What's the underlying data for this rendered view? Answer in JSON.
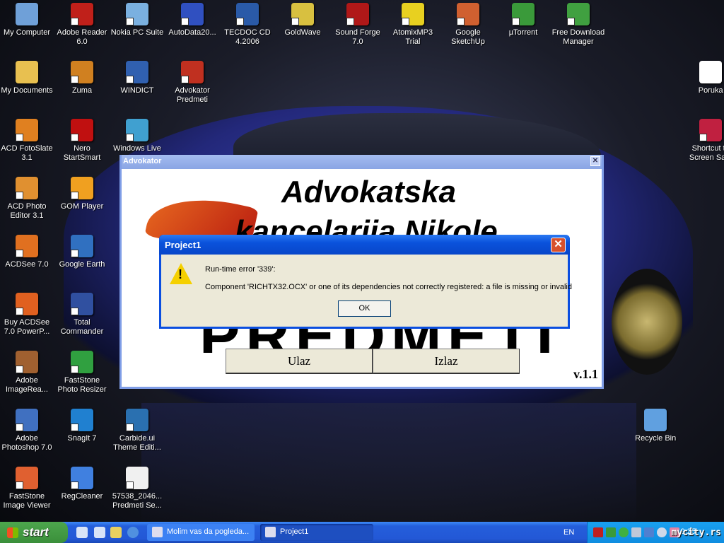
{
  "desktop_icons": [
    {
      "label": "My Computer",
      "col": 0,
      "row": 0,
      "color": "#6fa0d8",
      "shortcut": false
    },
    {
      "label": "Adobe Reader 6.0",
      "col": 1,
      "row": 0,
      "color": "#c0201a",
      "shortcut": true
    },
    {
      "label": "Nokia PC Suite",
      "col": 2,
      "row": 0,
      "color": "#7ab0e0",
      "shortcut": true
    },
    {
      "label": "AutoData20...",
      "col": 3,
      "row": 0,
      "color": "#3050c0",
      "shortcut": true
    },
    {
      "label": "TECDOC CD 4.2006",
      "col": 4,
      "row": 0,
      "color": "#2a5aa8",
      "shortcut": true
    },
    {
      "label": "GoldWave",
      "col": 5,
      "row": 0,
      "color": "#d8c040",
      "shortcut": true
    },
    {
      "label": "Sound Forge 7.0",
      "col": 6,
      "row": 0,
      "color": "#b01818",
      "shortcut": true
    },
    {
      "label": "AtomixMP3 Trial",
      "col": 7,
      "row": 0,
      "color": "#e8d020",
      "shortcut": true
    },
    {
      "label": "Google SketchUp",
      "col": 8,
      "row": 0,
      "color": "#d06030",
      "shortcut": true
    },
    {
      "label": "µTorrent",
      "col": 9,
      "row": 0,
      "color": "#3a9a3a",
      "shortcut": true
    },
    {
      "label": "Free Download Manager",
      "col": 10,
      "row": 0,
      "color": "#40a040",
      "shortcut": true
    },
    {
      "label": "My Documents",
      "col": 0,
      "row": 1,
      "color": "#e8c050",
      "shortcut": false
    },
    {
      "label": "Zuma",
      "col": 1,
      "row": 1,
      "color": "#d08020",
      "shortcut": true
    },
    {
      "label": "WINDICT",
      "col": 2,
      "row": 1,
      "color": "#3060b0",
      "shortcut": true
    },
    {
      "label": "Advokator Predmeti",
      "col": 3,
      "row": 1,
      "color": "#c03020",
      "shortcut": true
    },
    {
      "label": "ACD FotoSlate 3.1",
      "col": 0,
      "row": 2,
      "color": "#e08020",
      "shortcut": true
    },
    {
      "label": "Nero StartSmart",
      "col": 1,
      "row": 2,
      "color": "#c01010",
      "shortcut": true
    },
    {
      "label": "Windows Live",
      "col": 2,
      "row": 2,
      "color": "#40a0d0",
      "shortcut": true
    },
    {
      "label": "ACD Photo Editor 3.1",
      "col": 0,
      "row": 3,
      "color": "#e09030",
      "shortcut": true
    },
    {
      "label": "GOM Player",
      "col": 1,
      "row": 3,
      "color": "#f0a020",
      "shortcut": true
    },
    {
      "label": "ACDSee 7.0",
      "col": 0,
      "row": 4,
      "color": "#e07020",
      "shortcut": true
    },
    {
      "label": "Google Earth",
      "col": 1,
      "row": 4,
      "color": "#3070c0",
      "shortcut": true
    },
    {
      "label": "Buy ACDSee 7.0 PowerP...",
      "col": 0,
      "row": 5,
      "color": "#e06020",
      "shortcut": true
    },
    {
      "label": "Total Commander",
      "col": 1,
      "row": 5,
      "color": "#3050a0",
      "shortcut": true
    },
    {
      "label": "Adobe ImageRea...",
      "col": 0,
      "row": 6,
      "color": "#a06030",
      "shortcut": true
    },
    {
      "label": "FastStone Photo Resizer",
      "col": 1,
      "row": 6,
      "color": "#30a040",
      "shortcut": true
    },
    {
      "label": "Adobe Photoshop 7.0",
      "col": 0,
      "row": 7,
      "color": "#4070c0",
      "shortcut": true
    },
    {
      "label": "SnagIt 7",
      "col": 1,
      "row": 7,
      "color": "#2080d0",
      "shortcut": true
    },
    {
      "label": "Carbide.ui Theme Editi...",
      "col": 2,
      "row": 7,
      "color": "#2a70b0",
      "shortcut": true
    },
    {
      "label": "FastStone Image Viewer",
      "col": 0,
      "row": 8,
      "color": "#e06030",
      "shortcut": true
    },
    {
      "label": "RegCleaner",
      "col": 1,
      "row": 8,
      "color": "#4080e0",
      "shortcut": true
    },
    {
      "label": "57538_2046... Predmeti Se...",
      "col": 2,
      "row": 8,
      "color": "#f0f0f0",
      "shortcut": true
    },
    {
      "label": "Poruka",
      "col": 12.4,
      "row": 1,
      "color": "#ffffff",
      "shortcut": false
    },
    {
      "label": "Shortcut to Screen Sa...",
      "col": 12.4,
      "row": 2,
      "color": "#c02040",
      "shortcut": true
    },
    {
      "label": "Recycle Bin",
      "col": 11.4,
      "row": 7,
      "color": "#60a0e0",
      "shortcut": false
    }
  ],
  "app_window": {
    "title": "Advokator",
    "heading_line1": "Advokatska",
    "heading_line2": "kancelarija Nikole",
    "heading_line3": "PREDMETI",
    "enter_button": "Ulaz",
    "exit_button": "Izlaz",
    "version": "v.1.1"
  },
  "error_dialog": {
    "title": "Project1",
    "line1": "Run-time error '339':",
    "line2": "Component 'RICHTX32.OCX' or one of its dependencies not correctly registered: a file is missing or invalid",
    "ok_button": "OK",
    "close_symbol": "✕"
  },
  "taskbar": {
    "start_label": "start",
    "tasks": [
      "Molim vas da pogleda...",
      "Project1"
    ],
    "language": "EN",
    "clock": "9:25",
    "watermark": "mycity.rs"
  }
}
